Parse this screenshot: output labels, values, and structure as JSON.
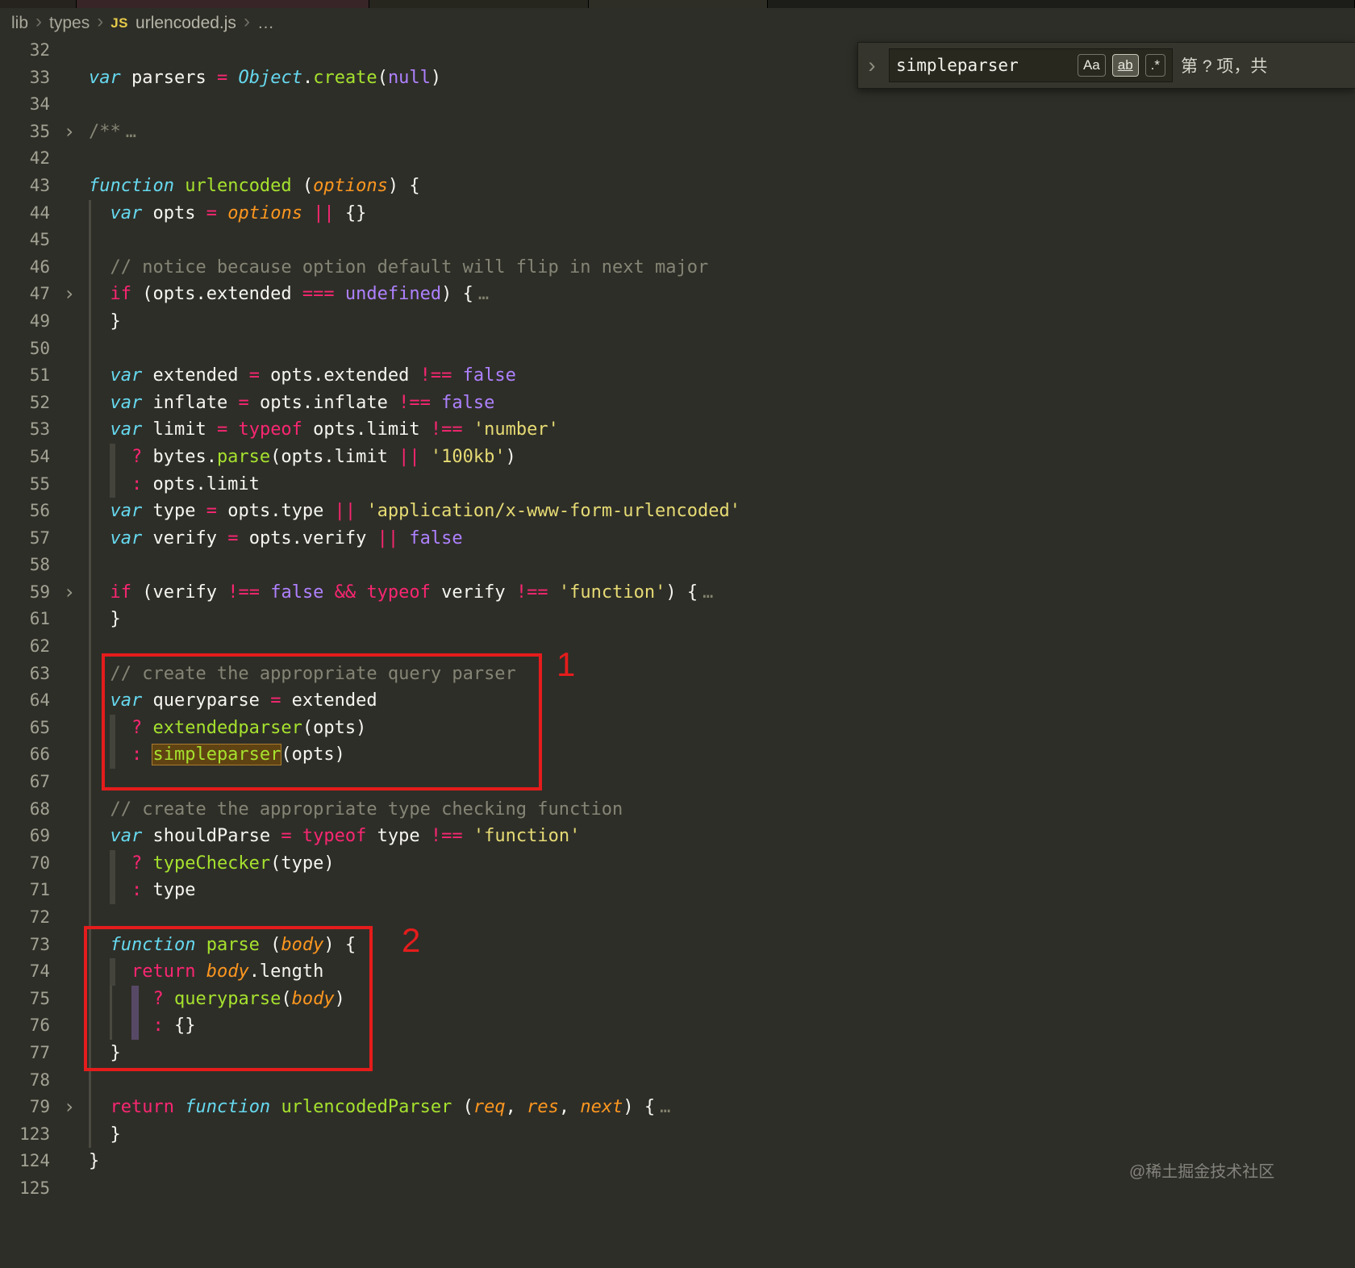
{
  "theme": {
    "bg": "#2e2e28",
    "fg": "#f6f5f0",
    "gutter": "#a2a294",
    "keyword": "#f92672",
    "storage": "#66d9ef",
    "string": "#e6db74",
    "constant": "#ae81ff",
    "func": "#a6e22e",
    "param": "#fd971f",
    "comment": "#858576",
    "annotation": "#e51c1c",
    "match": "#604312"
  },
  "breadcrumb": {
    "separator": "›",
    "file_icon": "JS",
    "items": [
      "lib",
      "types",
      "urlencoded.js",
      "…"
    ]
  },
  "find_widget": {
    "toggle_glyph": "›",
    "query": "simpleparser",
    "match_case_label": "Aa",
    "whole_word_label": "ab",
    "regex_label": ".*",
    "results_text": "第 ? 项，共"
  },
  "annotations": [
    {
      "label": "1"
    },
    {
      "label": "2"
    }
  ],
  "watermark": "@稀土掘金技术社区",
  "editor": {
    "language": "javascript",
    "lines": [
      {
        "n": 32,
        "i": 0,
        "t": []
      },
      {
        "n": 33,
        "i": 0,
        "t": [
          {
            "x": "var",
            "c": "s"
          },
          {
            "x": " parsers ",
            "c": "p"
          },
          {
            "x": "=",
            "c": "k"
          },
          {
            "x": " ",
            "c": "p"
          },
          {
            "x": "Object",
            "c": "t"
          },
          {
            "x": ".",
            "c": "p"
          },
          {
            "x": "create",
            "c": "f"
          },
          {
            "x": "(",
            "c": "p"
          },
          {
            "x": "null",
            "c": "c"
          },
          {
            "x": ")",
            "c": "p"
          }
        ]
      },
      {
        "n": 34,
        "i": 0,
        "t": []
      },
      {
        "n": 35,
        "i": 0,
        "fold": true,
        "t": [
          {
            "x": "/**",
            "c": "cm"
          },
          {
            "x": "…",
            "c": "e"
          }
        ]
      },
      {
        "n": 42,
        "i": 0,
        "t": []
      },
      {
        "n": 43,
        "i": 0,
        "t": [
          {
            "x": "function",
            "c": "s"
          },
          {
            "x": " ",
            "c": "p"
          },
          {
            "x": "urlencoded",
            "c": "f"
          },
          {
            "x": " (",
            "c": "p"
          },
          {
            "x": "options",
            "c": "a"
          },
          {
            "x": ") {",
            "c": "p"
          }
        ]
      },
      {
        "n": 44,
        "i": 1,
        "t": [
          {
            "x": "var",
            "c": "s"
          },
          {
            "x": " opts ",
            "c": "p"
          },
          {
            "x": "=",
            "c": "k"
          },
          {
            "x": " ",
            "c": "p"
          },
          {
            "x": "options",
            "c": "a"
          },
          {
            "x": " ",
            "c": "p"
          },
          {
            "x": "||",
            "c": "k"
          },
          {
            "x": " {}",
            "c": "p"
          }
        ]
      },
      {
        "n": 45,
        "i": 1,
        "t": []
      },
      {
        "n": 46,
        "i": 1,
        "t": [
          {
            "x": "// notice because option default will flip in next major",
            "c": "cm"
          }
        ]
      },
      {
        "n": 47,
        "i": 1,
        "fold": true,
        "t": [
          {
            "x": "if",
            "c": "k"
          },
          {
            "x": " (opts.extended ",
            "c": "p"
          },
          {
            "x": "===",
            "c": "k"
          },
          {
            "x": " ",
            "c": "p"
          },
          {
            "x": "undefined",
            "c": "c"
          },
          {
            "x": ") {",
            "c": "p"
          },
          {
            "x": "…",
            "c": "e"
          }
        ]
      },
      {
        "n": 49,
        "i": 1,
        "t": [
          {
            "x": "}",
            "c": "p"
          }
        ]
      },
      {
        "n": 50,
        "i": 1,
        "t": []
      },
      {
        "n": 51,
        "i": 1,
        "t": [
          {
            "x": "var",
            "c": "s"
          },
          {
            "x": " extended ",
            "c": "p"
          },
          {
            "x": "=",
            "c": "k"
          },
          {
            "x": " opts.extended ",
            "c": "p"
          },
          {
            "x": "!==",
            "c": "k"
          },
          {
            "x": " ",
            "c": "p"
          },
          {
            "x": "false",
            "c": "c"
          }
        ]
      },
      {
        "n": 52,
        "i": 1,
        "t": [
          {
            "x": "var",
            "c": "s"
          },
          {
            "x": " inflate ",
            "c": "p"
          },
          {
            "x": "=",
            "c": "k"
          },
          {
            "x": " opts.inflate ",
            "c": "p"
          },
          {
            "x": "!==",
            "c": "k"
          },
          {
            "x": " ",
            "c": "p"
          },
          {
            "x": "false",
            "c": "c"
          }
        ]
      },
      {
        "n": 53,
        "i": 1,
        "t": [
          {
            "x": "var",
            "c": "s"
          },
          {
            "x": " limit ",
            "c": "p"
          },
          {
            "x": "=",
            "c": "k"
          },
          {
            "x": " ",
            "c": "p"
          },
          {
            "x": "typeof",
            "c": "k"
          },
          {
            "x": " opts.limit ",
            "c": "p"
          },
          {
            "x": "!==",
            "c": "k"
          },
          {
            "x": " ",
            "c": "p"
          },
          {
            "x": "'number'",
            "c": "str"
          }
        ]
      },
      {
        "n": 54,
        "i": 2,
        "t": [
          {
            "x": "?",
            "c": "k"
          },
          {
            "x": " bytes.",
            "c": "p"
          },
          {
            "x": "parse",
            "c": "f"
          },
          {
            "x": "(opts.limit ",
            "c": "p"
          },
          {
            "x": "||",
            "c": "k"
          },
          {
            "x": " ",
            "c": "p"
          },
          {
            "x": "'100kb'",
            "c": "str"
          },
          {
            "x": ")",
            "c": "p"
          }
        ]
      },
      {
        "n": 55,
        "i": 2,
        "t": [
          {
            "x": ":",
            "c": "k"
          },
          {
            "x": " opts.limit",
            "c": "p"
          }
        ]
      },
      {
        "n": 56,
        "i": 1,
        "t": [
          {
            "x": "var",
            "c": "s"
          },
          {
            "x": " type ",
            "c": "p"
          },
          {
            "x": "=",
            "c": "k"
          },
          {
            "x": " opts.type ",
            "c": "p"
          },
          {
            "x": "||",
            "c": "k"
          },
          {
            "x": " ",
            "c": "p"
          },
          {
            "x": "'application/x-www-form-urlencoded'",
            "c": "str"
          }
        ]
      },
      {
        "n": 57,
        "i": 1,
        "t": [
          {
            "x": "var",
            "c": "s"
          },
          {
            "x": " verify ",
            "c": "p"
          },
          {
            "x": "=",
            "c": "k"
          },
          {
            "x": " opts.verify ",
            "c": "p"
          },
          {
            "x": "||",
            "c": "k"
          },
          {
            "x": " ",
            "c": "p"
          },
          {
            "x": "false",
            "c": "c"
          }
        ]
      },
      {
        "n": 58,
        "i": 1,
        "t": []
      },
      {
        "n": 59,
        "i": 1,
        "fold": true,
        "t": [
          {
            "x": "if",
            "c": "k"
          },
          {
            "x": " (verify ",
            "c": "p"
          },
          {
            "x": "!==",
            "c": "k"
          },
          {
            "x": " ",
            "c": "p"
          },
          {
            "x": "false",
            "c": "c"
          },
          {
            "x": " ",
            "c": "p"
          },
          {
            "x": "&&",
            "c": "k"
          },
          {
            "x": " ",
            "c": "p"
          },
          {
            "x": "typeof",
            "c": "k"
          },
          {
            "x": " verify ",
            "c": "p"
          },
          {
            "x": "!==",
            "c": "k"
          },
          {
            "x": " ",
            "c": "p"
          },
          {
            "x": "'function'",
            "c": "str"
          },
          {
            "x": ") {",
            "c": "p"
          },
          {
            "x": "…",
            "c": "e"
          }
        ]
      },
      {
        "n": 61,
        "i": 1,
        "t": [
          {
            "x": "}",
            "c": "p"
          }
        ]
      },
      {
        "n": 62,
        "i": 1,
        "t": []
      },
      {
        "n": 63,
        "i": 1,
        "t": [
          {
            "x": "// create the appropriate query parser",
            "c": "cm"
          }
        ]
      },
      {
        "n": 64,
        "i": 1,
        "t": [
          {
            "x": "var",
            "c": "s"
          },
          {
            "x": " queryparse ",
            "c": "p"
          },
          {
            "x": "=",
            "c": "k"
          },
          {
            "x": " extended",
            "c": "p"
          }
        ]
      },
      {
        "n": 65,
        "i": 2,
        "t": [
          {
            "x": "?",
            "c": "k"
          },
          {
            "x": " ",
            "c": "p"
          },
          {
            "x": "extendedparser",
            "c": "f"
          },
          {
            "x": "(opts)",
            "c": "p"
          }
        ]
      },
      {
        "n": 66,
        "i": 2,
        "t": [
          {
            "x": ":",
            "c": "k"
          },
          {
            "x": " ",
            "c": "p"
          },
          {
            "x": "simpleparser",
            "c": "hl"
          },
          {
            "x": "(opts)",
            "c": "p"
          }
        ]
      },
      {
        "n": 67,
        "i": 1,
        "t": []
      },
      {
        "n": 68,
        "i": 1,
        "t": [
          {
            "x": "// create the appropriate type checking function",
            "c": "cm"
          }
        ]
      },
      {
        "n": 69,
        "i": 1,
        "t": [
          {
            "x": "var",
            "c": "s"
          },
          {
            "x": " shouldParse ",
            "c": "p"
          },
          {
            "x": "=",
            "c": "k"
          },
          {
            "x": " ",
            "c": "p"
          },
          {
            "x": "typeof",
            "c": "k"
          },
          {
            "x": " type ",
            "c": "p"
          },
          {
            "x": "!==",
            "c": "k"
          },
          {
            "x": " ",
            "c": "p"
          },
          {
            "x": "'function'",
            "c": "str"
          }
        ]
      },
      {
        "n": 70,
        "i": 2,
        "t": [
          {
            "x": "?",
            "c": "k"
          },
          {
            "x": " ",
            "c": "p"
          },
          {
            "x": "typeChecker",
            "c": "f"
          },
          {
            "x": "(type)",
            "c": "p"
          }
        ]
      },
      {
        "n": 71,
        "i": 2,
        "t": [
          {
            "x": ":",
            "c": "k"
          },
          {
            "x": " type",
            "c": "p"
          }
        ]
      },
      {
        "n": 72,
        "i": 1,
        "t": []
      },
      {
        "n": 73,
        "i": 1,
        "t": [
          {
            "x": "function",
            "c": "s"
          },
          {
            "x": " ",
            "c": "p"
          },
          {
            "x": "parse",
            "c": "f"
          },
          {
            "x": " (",
            "c": "p"
          },
          {
            "x": "body",
            "c": "a"
          },
          {
            "x": ") {",
            "c": "p"
          }
        ]
      },
      {
        "n": 74,
        "i": 2,
        "t": [
          {
            "x": "return",
            "c": "k"
          },
          {
            "x": " ",
            "c": "p"
          },
          {
            "x": "body",
            "c": "a"
          },
          {
            "x": ".length",
            "c": "p"
          }
        ]
      },
      {
        "n": 75,
        "i": 3,
        "t": [
          {
            "x": "?",
            "c": "k"
          },
          {
            "x": " ",
            "c": "p"
          },
          {
            "x": "queryparse",
            "c": "f"
          },
          {
            "x": "(",
            "c": "p"
          },
          {
            "x": "body",
            "c": "a"
          },
          {
            "x": ")",
            "c": "p"
          }
        ]
      },
      {
        "n": 76,
        "i": 3,
        "t": [
          {
            "x": ":",
            "c": "k"
          },
          {
            "x": " {}",
            "c": "p"
          }
        ]
      },
      {
        "n": 77,
        "i": 1,
        "t": [
          {
            "x": "}",
            "c": "p"
          }
        ]
      },
      {
        "n": 78,
        "i": 1,
        "t": []
      },
      {
        "n": 79,
        "i": 1,
        "fold": true,
        "t": [
          {
            "x": "return",
            "c": "k"
          },
          {
            "x": " ",
            "c": "p"
          },
          {
            "x": "function",
            "c": "s"
          },
          {
            "x": " ",
            "c": "p"
          },
          {
            "x": "urlencodedParser",
            "c": "f"
          },
          {
            "x": " (",
            "c": "p"
          },
          {
            "x": "req",
            "c": "a"
          },
          {
            "x": ", ",
            "c": "p"
          },
          {
            "x": "res",
            "c": "a"
          },
          {
            "x": ", ",
            "c": "p"
          },
          {
            "x": "next",
            "c": "a"
          },
          {
            "x": ") {",
            "c": "p"
          },
          {
            "x": "…",
            "c": "e"
          }
        ]
      },
      {
        "n": 123,
        "i": 1,
        "t": [
          {
            "x": "}",
            "c": "p"
          }
        ]
      },
      {
        "n": 124,
        "i": 0,
        "t": [
          {
            "x": "}",
            "c": "p"
          }
        ]
      },
      {
        "n": 125,
        "i": 0,
        "t": []
      }
    ]
  }
}
